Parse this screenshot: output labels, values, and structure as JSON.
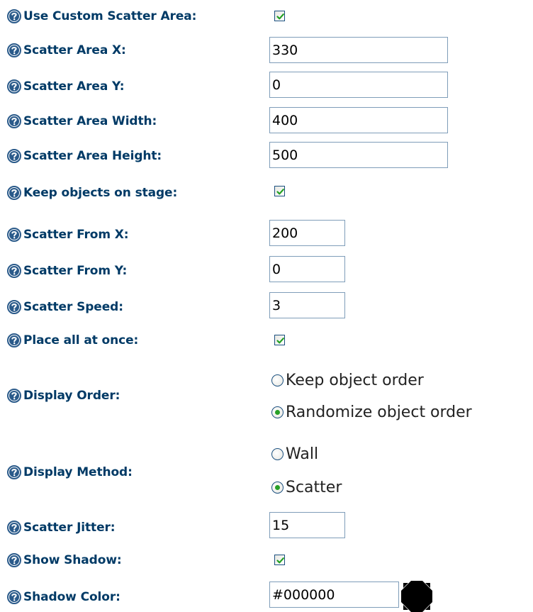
{
  "form": {
    "use_custom_scatter_area": {
      "label": "Use Custom Scatter Area:",
      "checked": true
    },
    "scatter_area_x": {
      "label": "Scatter Area X:",
      "value": "330"
    },
    "scatter_area_y": {
      "label": "Scatter Area Y:",
      "value": "0"
    },
    "scatter_area_width": {
      "label": "Scatter Area Width:",
      "value": "400"
    },
    "scatter_area_height": {
      "label": "Scatter Area Height:",
      "value": "500"
    },
    "keep_objects_on_stage": {
      "label": "Keep objects on stage:",
      "checked": true
    },
    "scatter_from_x": {
      "label": "Scatter From X:",
      "value": "200"
    },
    "scatter_from_y": {
      "label": "Scatter From Y:",
      "value": "0"
    },
    "scatter_speed": {
      "label": "Scatter Speed:",
      "value": "3"
    },
    "place_all_at_once": {
      "label": "Place all at once:",
      "checked": true
    },
    "display_order": {
      "label": "Display Order:",
      "options": [
        "Keep object order",
        "Randomize object order"
      ],
      "selected": "Randomize object order"
    },
    "display_method": {
      "label": "Display Method:",
      "options": [
        "Wall",
        "Scatter"
      ],
      "selected": "Scatter"
    },
    "scatter_jitter": {
      "label": "Scatter Jitter:",
      "value": "15"
    },
    "show_shadow": {
      "label": "Show Shadow:",
      "checked": true
    },
    "shadow_color": {
      "label": "Shadow Color:",
      "value": "#000000",
      "swatch_color": "#000000"
    }
  },
  "icons": {
    "help": "help-question-icon",
    "checkmark": "checkmark-icon",
    "color_picker": "color-picker-icon"
  },
  "colors": {
    "label_text": "#003a66",
    "checkmark": "#22a022",
    "help_icon": "#2a5a8a"
  }
}
